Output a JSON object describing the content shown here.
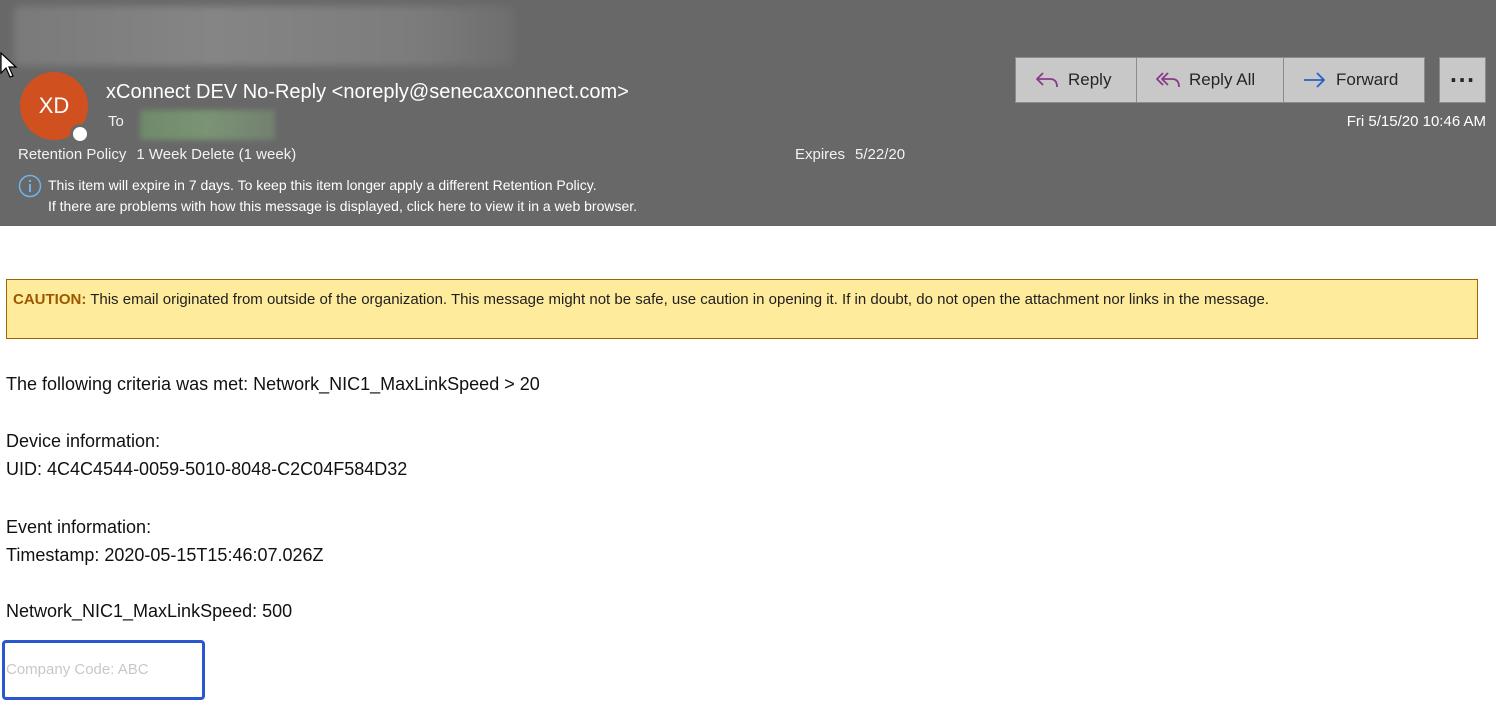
{
  "header": {
    "avatar_initials": "XD",
    "sender": "xConnect DEV No-Reply <noreply@senecaxconnect.com>",
    "to_label": "To",
    "datetime": "Fri 5/15/20 10:46 AM",
    "retention_label": "Retention Policy",
    "retention_value": "1 Week Delete (1 week)",
    "expires_label": "Expires",
    "expires_value": "5/22/20",
    "info_line1": "This item will expire in 7 days. To keep this item longer apply a different Retention Policy.",
    "info_line2": "If there are problems with how this message is displayed, click here to view it in a web browser."
  },
  "actions": {
    "reply": "Reply",
    "reply_all": "Reply All",
    "forward": "Forward",
    "more": "···"
  },
  "body": {
    "caution_label": "CAUTION:",
    "caution_text": " This email originated from outside of the organization. This message might not be safe, use caution in opening it. If in doubt, do not open the attachment nor links in the message.",
    "criteria": "The following criteria was met: Network_NIC1_MaxLinkSpeed > 20",
    "device_heading": "Device information:",
    "uid": "UID: 4C4C4544-0059-5010-8048-C2C04F584D32",
    "event_heading": "Event information:",
    "timestamp": "Timestamp: 2020-05-15T15:46:07.026Z",
    "metric": "Network_NIC1_MaxLinkSpeed: 500",
    "company_code": "Company Code: ABC"
  },
  "colors": {
    "header_bg": "#686868",
    "avatar": "#d0501f",
    "reply_icon": "#8a3a8a",
    "forward_icon": "#2a5fc7",
    "caution_bg": "#ffeb9c",
    "highlight_box": "#2a56d0"
  }
}
